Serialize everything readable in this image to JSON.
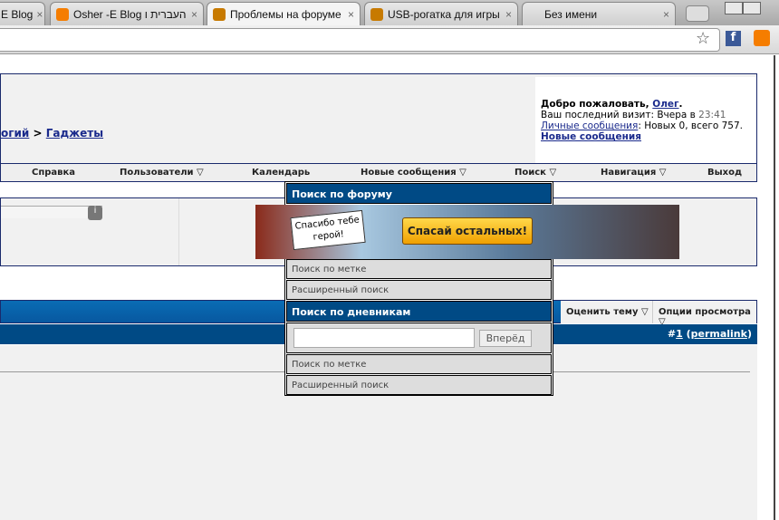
{
  "browser": {
    "tabs": [
      {
        "title": "E Blog",
        "icon": "blogger-icon",
        "color": "#f57d00"
      },
      {
        "title": "Osher -E Blog העברית ו",
        "icon": "blogger-icon",
        "color": "#f57d00"
      },
      {
        "title": "Проблемы на форуме",
        "icon": "forum-icon",
        "color": "#c77a00",
        "active": true
      },
      {
        "title": "USB-рогатка для игры",
        "icon": "forum-icon",
        "color": "#c77a00"
      },
      {
        "title": "Без имени"
      }
    ],
    "close": "×"
  },
  "header": {
    "breadcrumb_prev": "огий",
    "breadcrumb_sep": " > ",
    "breadcrumb_current": "Гаджеты",
    "welcome": {
      "greeting": "Добро пожаловать, ",
      "user": "Олег",
      "dot": ".",
      "last_visit_label": "Ваш последний визит: Вчера в ",
      "last_visit_time": "23:41",
      "pm_link": "Личные сообщения",
      "pm_text": ": Новых 0, всего 757.",
      "new_posts": "Новые сообщения"
    }
  },
  "navbar": [
    "Справка",
    "Пользователи ▽",
    "Календарь",
    "Новые сообщения ▽",
    "Поиск ▽",
    "Навигация ▽",
    "Выход"
  ],
  "banner": {
    "bubble": "Спасибо тебе герой!",
    "button": "Спасай остальных!"
  },
  "thread": {
    "rate": "Оценить тему ▽",
    "view": "Опции просмотра ▽",
    "post_num_prefix": "#",
    "post_num": "1",
    "permalink": "permalink"
  },
  "dropdown": {
    "forum_header": "Поиск по форуму",
    "forum_tag": "Поиск по метке",
    "forum_adv": "Расширенный поиск",
    "blog_header": "Поиск по дневникам",
    "search_value": "",
    "go": "Вперёд",
    "blog_tag": "Поиск по метке",
    "blog_adv": "Расширенный поиск"
  }
}
